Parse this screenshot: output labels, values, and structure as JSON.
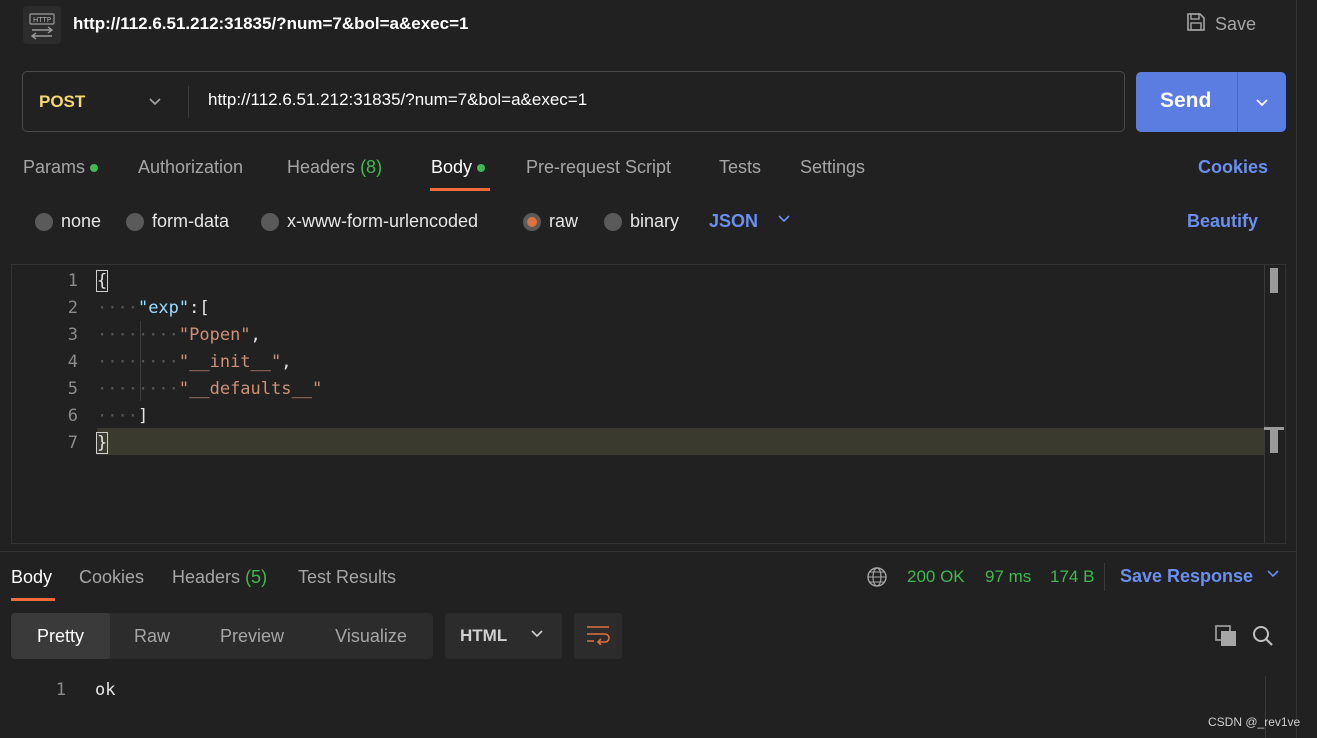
{
  "request": {
    "title": "http://112.6.51.212:31835/?num=7&bol=a&exec=1",
    "save_label": "Save",
    "method": "POST",
    "url": "http://112.6.51.212:31835/?num=7&bol=a&exec=1",
    "send_label": "Send"
  },
  "request_tabs": {
    "params": "Params",
    "authorization": "Authorization",
    "headers": "Headers",
    "headers_count": "(8)",
    "body": "Body",
    "pre_request": "Pre-request Script",
    "tests": "Tests",
    "settings": "Settings",
    "cookies": "Cookies"
  },
  "body_types": {
    "none": "none",
    "form_data": "form-data",
    "urlencoded": "x-www-form-urlencoded",
    "raw": "raw",
    "binary": "binary",
    "selected": "raw",
    "format": "JSON",
    "beautify": "Beautify"
  },
  "editor": {
    "line_numbers": [
      "1",
      "2",
      "3",
      "4",
      "5",
      "6",
      "7"
    ],
    "lines": {
      "l1": "{",
      "l2_key": "\"exp\"",
      "l2_rest": ":[",
      "l3_str": "\"Popen\"",
      "l3_rest": ",",
      "l4_str": "\"__init__\"",
      "l4_rest": ",",
      "l5_str": "\"__defaults__\"",
      "l6": "]",
      "l7": "}"
    }
  },
  "response_tabs": {
    "body": "Body",
    "cookies": "Cookies",
    "headers": "Headers",
    "headers_count": "(5)",
    "test_results": "Test Results"
  },
  "response_status": {
    "status": "200 OK",
    "time": "97 ms",
    "size": "174 B",
    "save_response": "Save Response"
  },
  "response_view": {
    "pretty": "Pretty",
    "raw": "Raw",
    "preview": "Preview",
    "visualize": "Visualize",
    "format": "HTML"
  },
  "response_body": {
    "line_number": "1",
    "content": "ok"
  },
  "watermark": "CSDN @_rev1ve",
  "colors": {
    "accent": "#5b7ce0",
    "method": "#f5d76e",
    "success": "#3fb950",
    "tab_underline": "#f26b3a"
  }
}
